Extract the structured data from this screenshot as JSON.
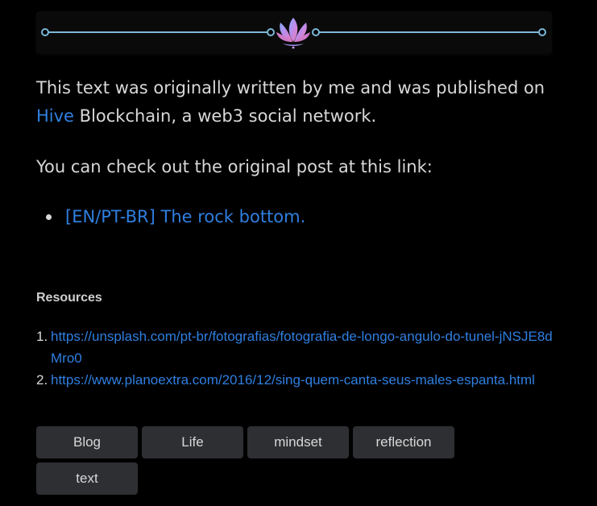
{
  "divider": {
    "icon": "lotus-icon",
    "line_color": "#7ab8d8"
  },
  "content": {
    "intro_before_link": "This text was originally written by me and was published on ",
    "intro_link": "Hive",
    "intro_after_link": " Blockchain, a web3 social network.",
    "check_text": "You can check out the original post at this link:",
    "bullet_link": "[EN/PT-BR] The rock bottom."
  },
  "resources": {
    "title": "Resources",
    "items": [
      {
        "num": "1.",
        "url": "https://unsplash.com/pt-br/fotografias/fotografia-de-longo-angulo-do-tunel-jNSJE8dMro0"
      },
      {
        "num": "2.",
        "url": "https://www.planoextra.com/2016/12/sing-quem-canta-seus-males-espanta.html"
      }
    ]
  },
  "tags": [
    "Blog",
    "Life",
    "mindset",
    "reflection",
    "text"
  ],
  "colors": {
    "background": "#000000",
    "text": "#d8d8d8",
    "link": "#2f7fe0",
    "tag_bg": "#2e2f32"
  }
}
